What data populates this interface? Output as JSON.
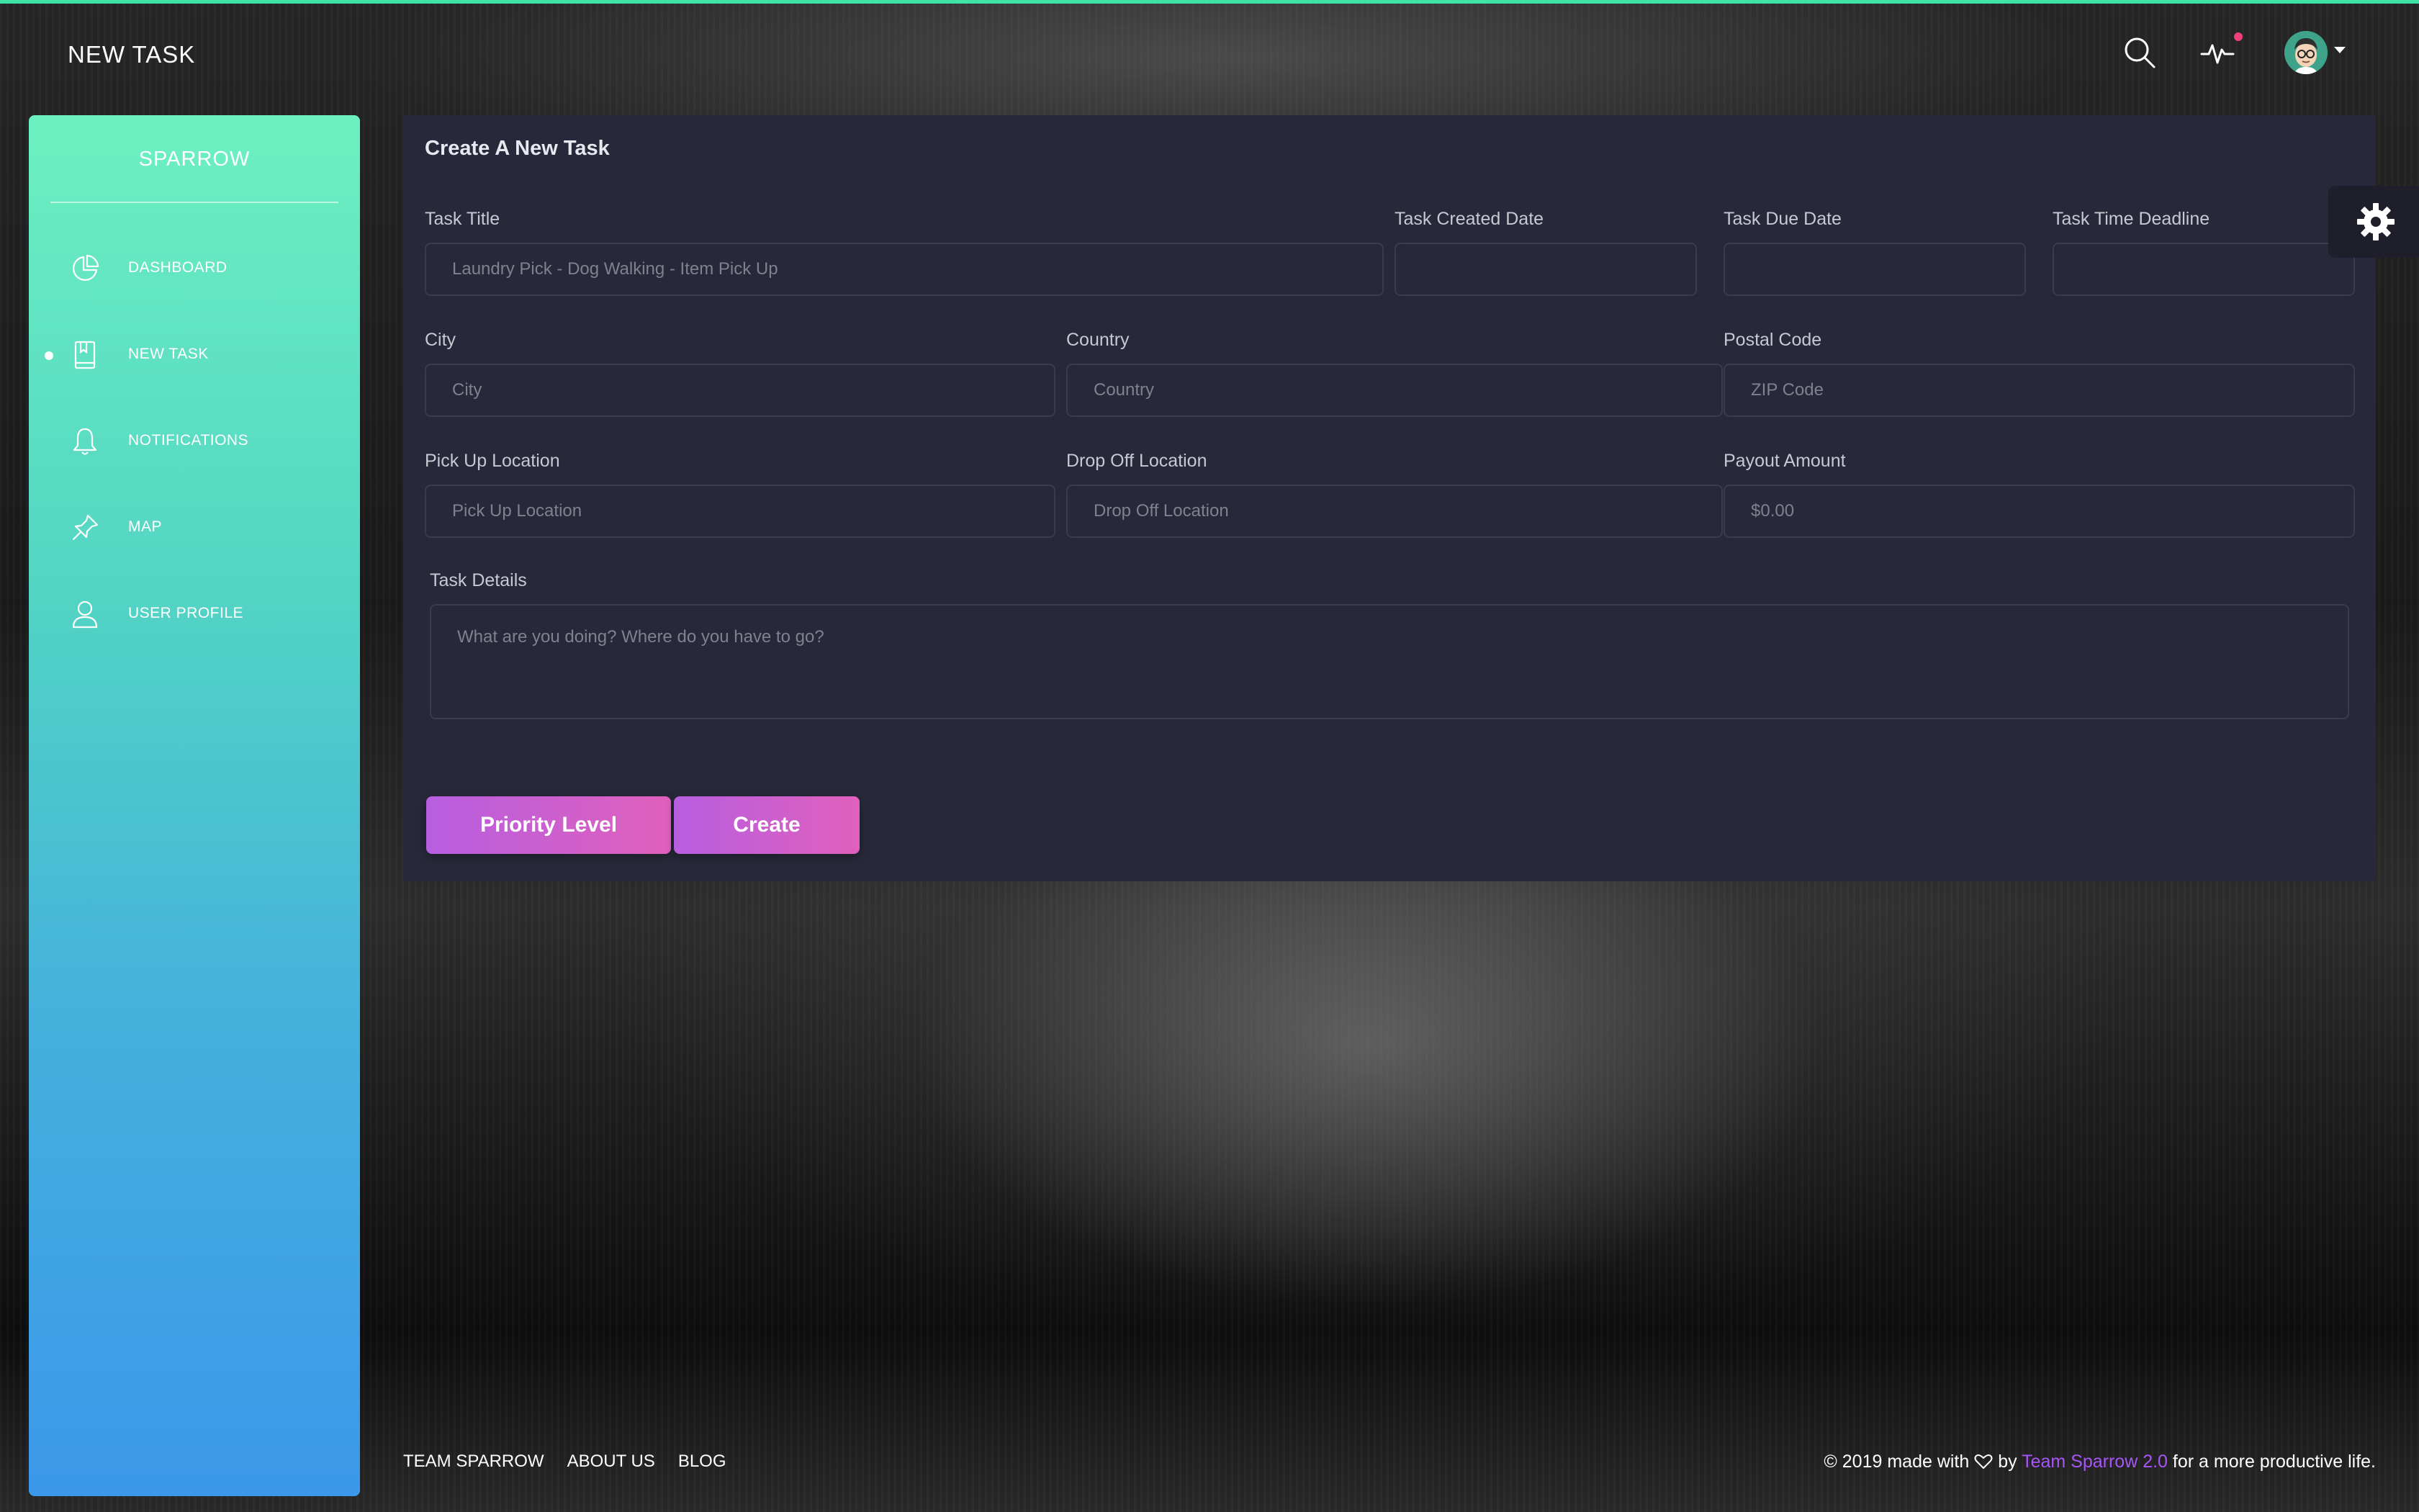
{
  "header": {
    "title": "NEW TASK"
  },
  "sidebar": {
    "brand": "SPARROW",
    "items": [
      {
        "label": "DASHBOARD",
        "icon": "pie-chart-icon",
        "active": false
      },
      {
        "label": "NEW TASK",
        "icon": "book-icon",
        "active": true
      },
      {
        "label": "NOTIFICATIONS",
        "icon": "bell-icon",
        "active": false
      },
      {
        "label": "MAP",
        "icon": "pin-icon",
        "active": false
      },
      {
        "label": "USER PROFILE",
        "icon": "user-icon",
        "active": false
      }
    ]
  },
  "form": {
    "title": "Create A New Task",
    "task_title": {
      "label": "Task Title",
      "placeholder": "Laundry Pick - Dog Walking  - Item Pick Up"
    },
    "created_date": {
      "label": "Task Created Date",
      "placeholder": ""
    },
    "due_date": {
      "label": "Task Due Date",
      "placeholder": ""
    },
    "time_deadline": {
      "label": "Task Time Deadline",
      "placeholder": ""
    },
    "city": {
      "label": "City",
      "placeholder": "City"
    },
    "country": {
      "label": "Country",
      "placeholder": "Country"
    },
    "postal": {
      "label": "Postal Code",
      "placeholder": "ZIP Code"
    },
    "pickup": {
      "label": "Pick Up Location",
      "placeholder": "Pick Up Location"
    },
    "dropoff": {
      "label": "Drop Off Location",
      "placeholder": "Drop Off Location"
    },
    "payout": {
      "label": "Payout Amount",
      "placeholder": "$0.00"
    },
    "details": {
      "label": "Task Details",
      "placeholder": "What are you doing?    Where do you have to go?"
    },
    "priority_button": "Priority Level",
    "create_button": "Create"
  },
  "footer": {
    "links": [
      "TEAM SPARROW",
      "ABOUT US",
      "BLOG"
    ],
    "copy_prefix": "© 2019 made with",
    "copy_by": "by",
    "copy_team": "Team Sparrow 2.0",
    "copy_suffix": "for a more productive life."
  },
  "colors": {
    "accent_top": "#3fe3a3",
    "sidebar_top": "#6df0c0",
    "sidebar_bottom": "#3b98ea",
    "button_gradient_start": "#b75ee0",
    "button_gradient_end": "#e060bc",
    "notification_dot": "#ec407a",
    "footer_brand": "#a855f7"
  }
}
